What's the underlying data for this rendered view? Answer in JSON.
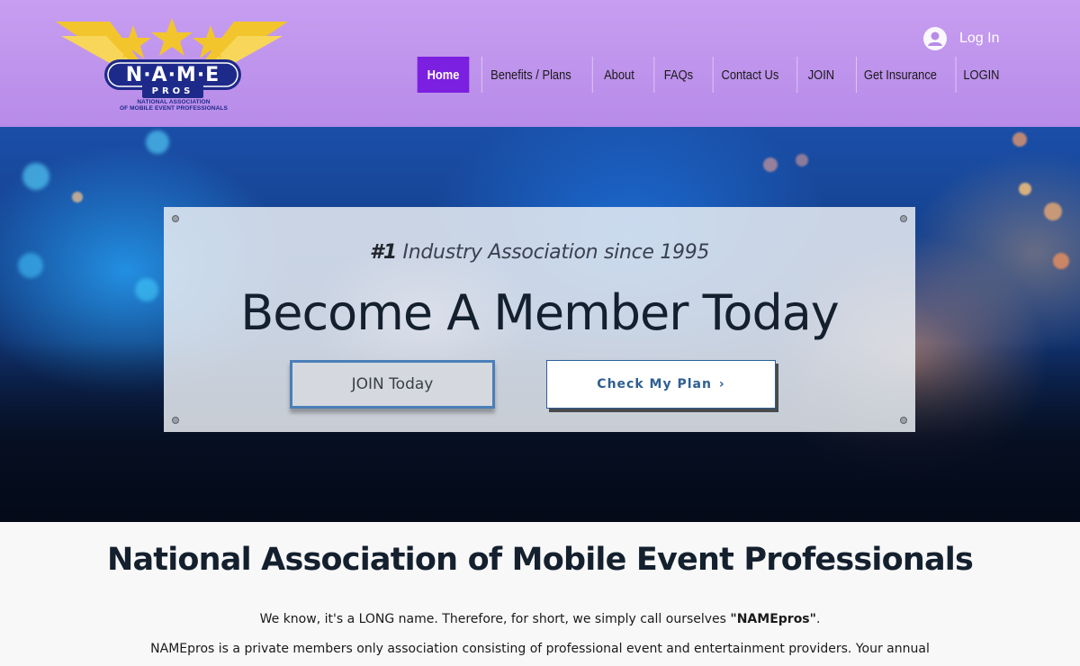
{
  "brand": {
    "logo_text": "N·A·M·E",
    "logo_pros": "PROS",
    "logo_subtitle_line1": "NATIONAL ASSOCIATION",
    "logo_subtitle_line2": "OF MOBILE EVENT PROFESSIONALS"
  },
  "header": {
    "login_label": "Log In",
    "nav": [
      {
        "label": "Home",
        "active": true
      },
      {
        "label": "Benefits / Plans",
        "active": false
      },
      {
        "label": "About",
        "active": false
      },
      {
        "label": "FAQs",
        "active": false
      },
      {
        "label": "Contact Us",
        "active": false
      },
      {
        "label": "JOIN",
        "active": false
      },
      {
        "label": "Get Insurance",
        "active": false
      },
      {
        "label": "LOGIN",
        "active": false
      }
    ]
  },
  "hero": {
    "tagline_number": "#1",
    "tagline_rest": " Industry Association since 1995",
    "title": "Become A Member Today",
    "join_button": "JOIN Today",
    "plan_button": "Check My Plan",
    "plan_button_icon": "chevron-right-icon"
  },
  "content": {
    "title": "National Association of Mobile Event Professionals",
    "p1_before": "We know, it's a LONG name. Therefore, for short, we simply call ourselves ",
    "p1_bold": "\"NAMEpros\"",
    "p1_after": ".",
    "p2": "NAMEpros is a private members only association consisting of professional event and entertainment providers. Your annual"
  },
  "colors": {
    "header_bg": "#c79ef1",
    "nav_active_bg": "#7b1fe0",
    "logo_navy": "#1e2a8a",
    "logo_gold": "#f3c52c",
    "accent_blue": "#2e5f92"
  }
}
